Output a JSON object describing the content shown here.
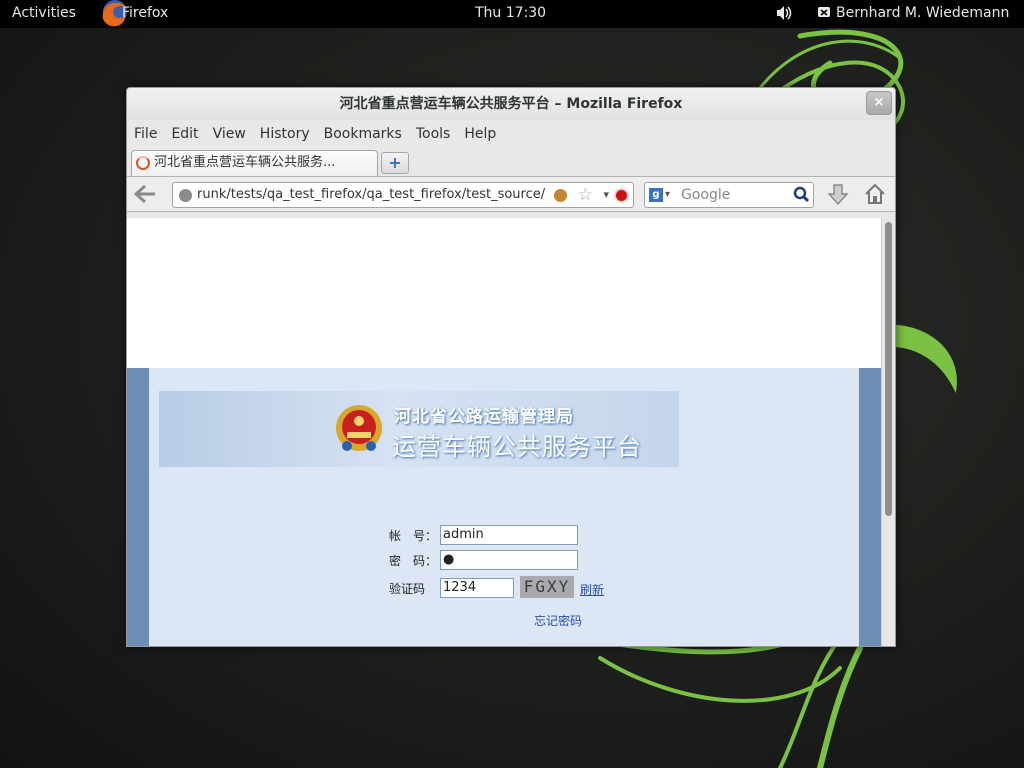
{
  "topbar": {
    "activities": "Activities",
    "app_name": "Firefox",
    "clock": "Thu 17:30",
    "user": "Bernhard M. Wiedemann"
  },
  "window": {
    "title": "河北省重点营运车辆公共服务平台 – Mozilla Firefox",
    "close_glyph": "×"
  },
  "menu": [
    "File",
    "Edit",
    "View",
    "History",
    "Bookmarks",
    "Tools",
    "Help"
  ],
  "tab": {
    "label": "河北省重点营运车辆公共服务...",
    "new_tab_glyph": "+"
  },
  "navbar": {
    "url": "runk/tests/qa_test_firefox/qa_test_firefox/test_source/",
    "search_placeholder": "Google",
    "search_engine_glyph": "g"
  },
  "page": {
    "banner_line1": "河北省公路运输管理局",
    "banner_line2": "运营车辆公共服务平台",
    "account_label": "帐　号：",
    "account_value": "admin",
    "password_label": "密　码：",
    "password_value": "●",
    "captcha_label": "验证码",
    "captcha_input": "1234",
    "captcha_image_text": "FGXY",
    "refresh_link": "刷新",
    "forgot_link": "忘记密码"
  },
  "colors": {
    "band": "#dde6f5",
    "band_side": "#6e8fb5",
    "link": "#2a4fa8",
    "desktop_swirl": "#7bc143"
  }
}
